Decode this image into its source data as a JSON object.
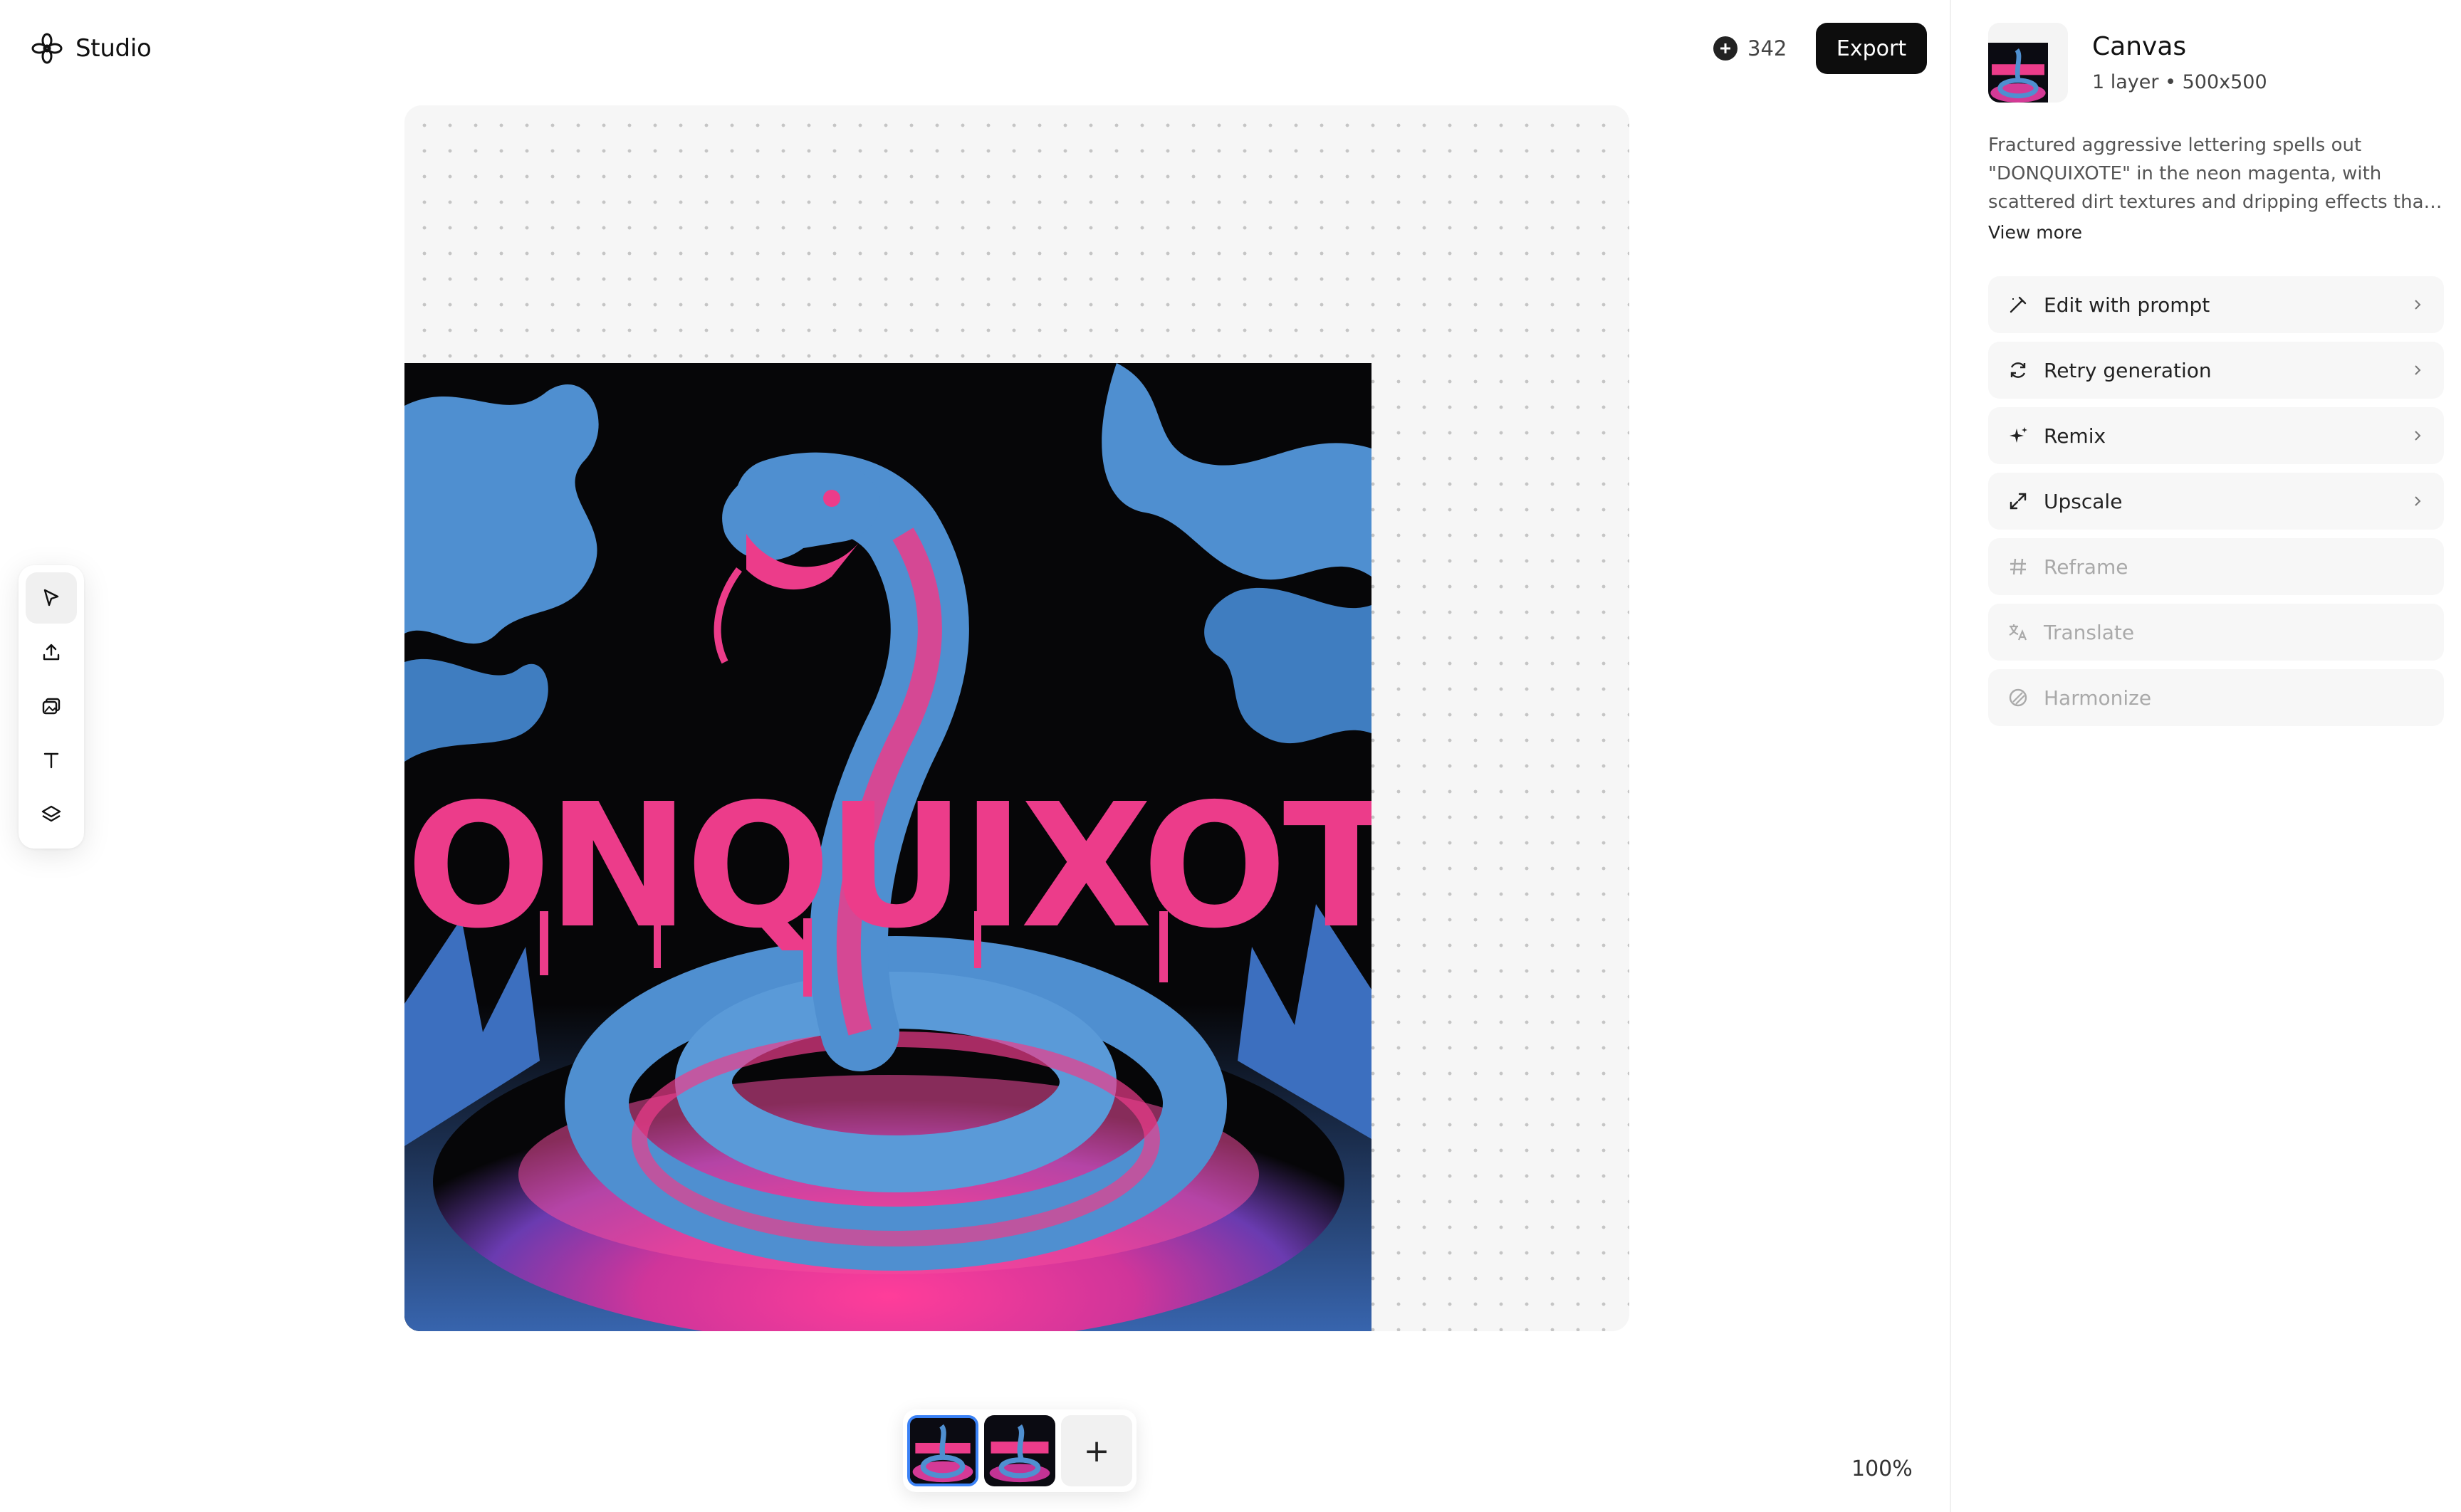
{
  "header": {
    "app_name": "Studio",
    "credits": "342",
    "export_label": "Export"
  },
  "artwork": {
    "text": "DONQUIXOTE",
    "colors": {
      "background": "#060608",
      "magenta": "#ec3c8a",
      "snake_blue": "#4f8fd0"
    }
  },
  "toolbar": {
    "tools": [
      "select-cursor-icon",
      "upload-icon",
      "image-icon",
      "text-icon",
      "layers-icon"
    ]
  },
  "thumbnails": {
    "add_symbol": "+",
    "selected_index": 0
  },
  "zoom": "100%",
  "panel": {
    "title": "Canvas",
    "meta": "1 layer • 500x500",
    "description": "Fractured aggressive lettering spells out \"DONQUIXOTE\" in the neon magenta, with scattered dirt textures and dripping effects that make the text...",
    "view_more": "View more",
    "actions": [
      {
        "label": "Edit with prompt",
        "icon": "wand-icon",
        "enabled": true
      },
      {
        "label": "Retry generation",
        "icon": "refresh-icon",
        "enabled": true
      },
      {
        "label": "Remix",
        "icon": "sparkle-icon",
        "enabled": true
      },
      {
        "label": "Upscale",
        "icon": "expand-icon",
        "enabled": true
      },
      {
        "label": "Reframe",
        "icon": "hash-icon",
        "enabled": false
      },
      {
        "label": "Translate",
        "icon": "translate-icon",
        "enabled": false
      },
      {
        "label": "Harmonize",
        "icon": "harmonize-icon",
        "enabled": false
      }
    ]
  }
}
